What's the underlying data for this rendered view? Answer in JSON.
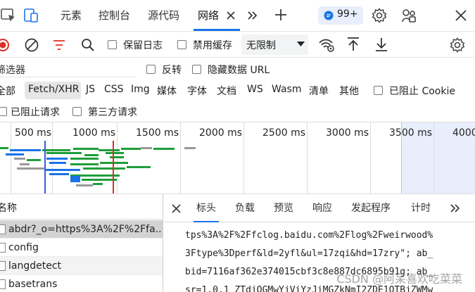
{
  "tabs": {
    "items": [
      "元素",
      "控制台",
      "源代码",
      "网络"
    ],
    "badge": "99+"
  },
  "toolbar": {
    "preserve_log": "保留日志",
    "disable_cache": "禁用缓存",
    "throttle_value": "无限制"
  },
  "filter": {
    "placeholder": "筛选器",
    "invert": "反转",
    "hide_data_urls": "隐藏数据 URL"
  },
  "types": {
    "items": [
      "全部",
      "Fetch/XHR",
      "JS",
      "CSS",
      "Img",
      "媒体",
      "字体",
      "文档",
      "WS",
      "Wasm",
      "清单",
      "其他"
    ],
    "blocked_cookie": "已阻止 Cookie",
    "blocked_requests": "已阻止请求",
    "third_party": "第三方请求"
  },
  "timeline": {
    "ticks": [
      "500 ms",
      "1000 ms",
      "1500 ms",
      "2000 ms",
      "2500 ms",
      "3000 ms",
      "3500 ms",
      "4000"
    ]
  },
  "requests": {
    "header": "名称",
    "items": [
      "abdr?_o=https%3A%2F%2Ffa...",
      "config",
      "langdetect",
      "basetrans"
    ]
  },
  "details": {
    "tabs": [
      "标头",
      "负载",
      "预览",
      "响应",
      "发起程序",
      "计时"
    ],
    "lines": [
      "tps%3A%2F%2Ffclog.baidu.com%2Flog%2Fweirwood%",
      "3Ftype%3Dperf&ld=2yfl&ul=17zqi&hd=17zry\"; ab_",
      "bid=7116af362e374015cbf3c8e887dc6895b91g; ab_",
      "sr=1.0.1_ZTdjOGMwYjViYzJiMGZkNmI2ZDE1OTBjZWMw"
    ]
  },
  "watermark": "CSDN @阿呆喜欢吃菜菜",
  "colors": {
    "accent": "#1a73e8",
    "record": "#d93025",
    "filter_icon": "#e8453c",
    "green_bar": "#1e9e3a",
    "blue_bar": "#1a73e8"
  }
}
